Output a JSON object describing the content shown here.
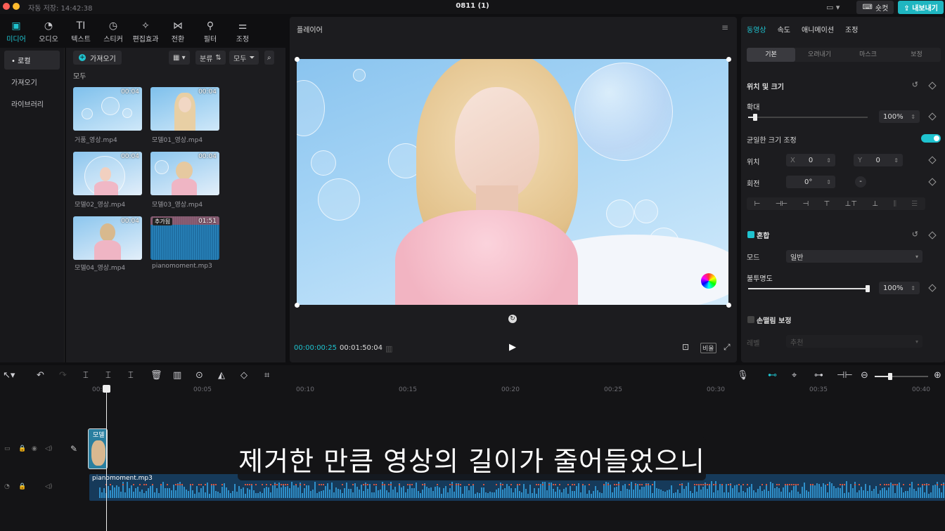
{
  "titlebar": {
    "autosave": "자동 저장: 14:42:38",
    "title": "0811 (1)",
    "shortcut": "숏컷",
    "export": "내보내기",
    "colors": {
      "close": "#ff5f57",
      "min": "#febc2e"
    }
  },
  "tools": [
    {
      "label": "미디어",
      "icon": "media-icon"
    },
    {
      "label": "오디오",
      "icon": "audio-icon"
    },
    {
      "label": "텍스트",
      "icon": "text-icon"
    },
    {
      "label": "스티커",
      "icon": "sticker-icon"
    },
    {
      "label": "편집효과",
      "icon": "effects-icon"
    },
    {
      "label": "전환",
      "icon": "transition-icon"
    },
    {
      "label": "필터",
      "icon": "filter-icon"
    },
    {
      "label": "조정",
      "icon": "adjust-icon"
    }
  ],
  "sidebar": {
    "items": [
      "• 로컬",
      "가져오기",
      "라이브러리"
    ]
  },
  "media": {
    "import": "가져오기",
    "sort": "분류",
    "all_filter": "모두",
    "section": "모두",
    "items": [
      {
        "name": "거품_영상.mp4",
        "duration": "00:04"
      },
      {
        "name": "모델01_영상.mp4",
        "duration": "00:04"
      },
      {
        "name": "모델02_영상.mp4",
        "duration": "00:04"
      },
      {
        "name": "모델03_영상.mp4",
        "duration": "00:04"
      },
      {
        "name": "모델04_영상.mp4",
        "duration": "00:04"
      },
      {
        "name": "pianomoment.mp3",
        "duration": "01:51",
        "badge": "추가됨"
      }
    ]
  },
  "player": {
    "title": "플레이어",
    "current": "00:00:00:25",
    "total": "00:01:50:04",
    "ratio": "비율"
  },
  "props": {
    "tabs": [
      "동영상",
      "속도",
      "애니메이션",
      "조정"
    ],
    "subtabs": [
      "기본",
      "오려내기",
      "마스크",
      "보정"
    ],
    "pos_size": "위치 및 크기",
    "scale_label": "확대",
    "scale": "100%",
    "scale_value": 0.06,
    "uniform": "균일한 크기 조정",
    "position": "위치",
    "x_label": "X",
    "x": "0",
    "y_label": "Y",
    "y": "0",
    "rotate": "회전",
    "rotation": "0°",
    "rotate_knob": "-",
    "blend": "혼합",
    "mode_label": "모드",
    "mode": "일반",
    "opacity_label": "불투명도",
    "opacity": "100%",
    "opacity_value": 1.0,
    "chroma": "손떨림 보정",
    "level_label": "레벨",
    "level": "추천"
  },
  "timeline": {
    "ruler": [
      "00:00",
      "00:05",
      "00:10",
      "00:15",
      "00:20",
      "00:25",
      "00:30",
      "00:35",
      "00:40"
    ],
    "video_clip": "모델",
    "audio_clip": "pianomoment.mp3",
    "subtitle": "제거한 만큼 영상의 길이가 줄어들었으니"
  }
}
